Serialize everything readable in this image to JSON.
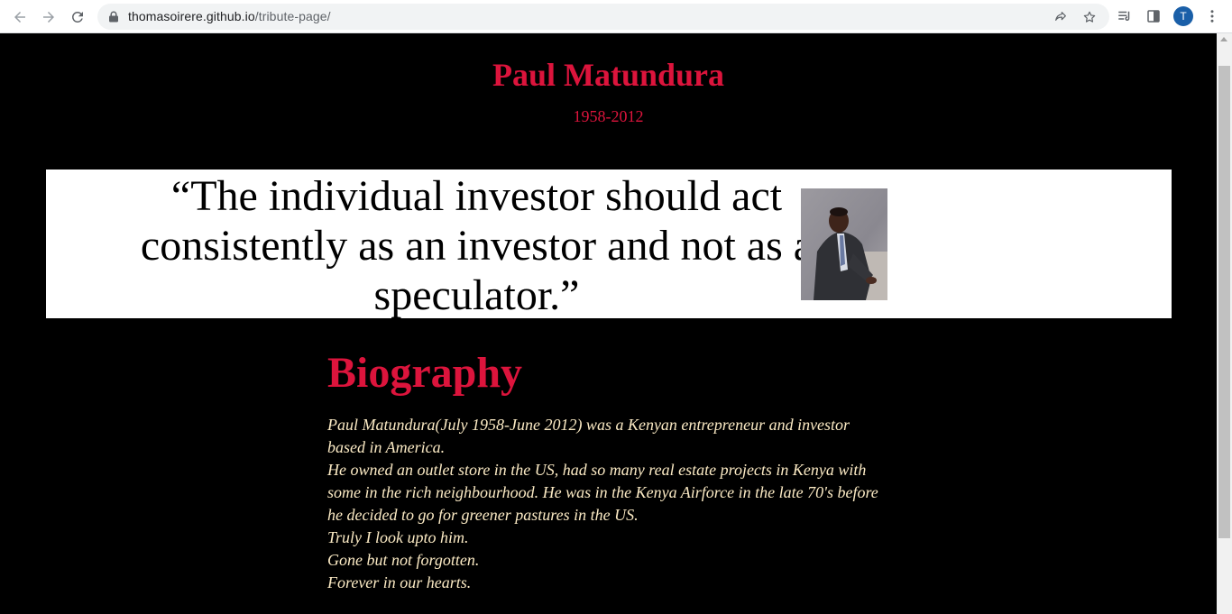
{
  "browser": {
    "url_host": "thomasoirere.github.io",
    "url_path": "/tribute-page/",
    "avatar_letter": "T",
    "icons": [
      "back-arrow-icon",
      "forward-arrow-icon",
      "reload-icon",
      "lock-icon",
      "share-icon",
      "star-icon",
      "media-queue-icon",
      "side-panel-icon",
      "menu-icon"
    ]
  },
  "colors": {
    "accent": "#dc143c",
    "bio_text": "#fbeac4",
    "background": "#000000",
    "quote_box": "#ffffff"
  },
  "header": {
    "title": "Paul Matundura",
    "dates": "1958-2012"
  },
  "quote": {
    "text": "“The individual investor should act consistently as an investor and not as a speculator.”"
  },
  "biography": {
    "heading": "Biography",
    "lines": [
      "Paul Matundura(July 1958-June 2012) was a Kenyan entrepreneur and investor based in America.",
      "He owned an outlet store in the US, had so many real estate projects in Kenya with some in the rich neighbourhood. He was in the Kenya Airforce in the late 70's before he decided to go for greener pastures in the US.",
      "Truly I look upto him.",
      "Gone but not forgotten.",
      "Forever in our hearts."
    ]
  }
}
